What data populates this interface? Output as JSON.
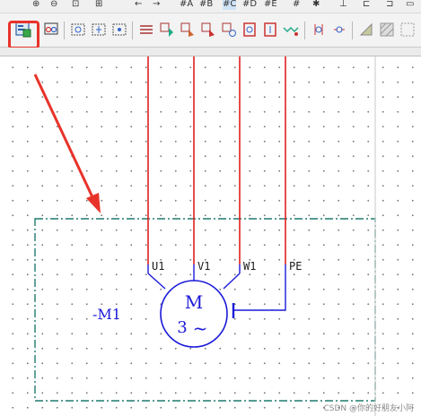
{
  "toolbar": {
    "row1_labels": [
      "A",
      "B",
      "C",
      "D",
      "E"
    ]
  },
  "device": {
    "tag": "-M1",
    "motor_symbol": "M",
    "phase_count": "3",
    "ac_symbol": "~",
    "terminals": [
      "U1",
      "V1",
      "W1",
      "PE"
    ]
  },
  "colors": {
    "wire_phase": "#e02020",
    "wire_terminal": "#1a1ad8",
    "device_box": "#1f7a6e",
    "highlight": "#e8332a"
  },
  "watermark": "CSDN @你的好朋友小阿"
}
